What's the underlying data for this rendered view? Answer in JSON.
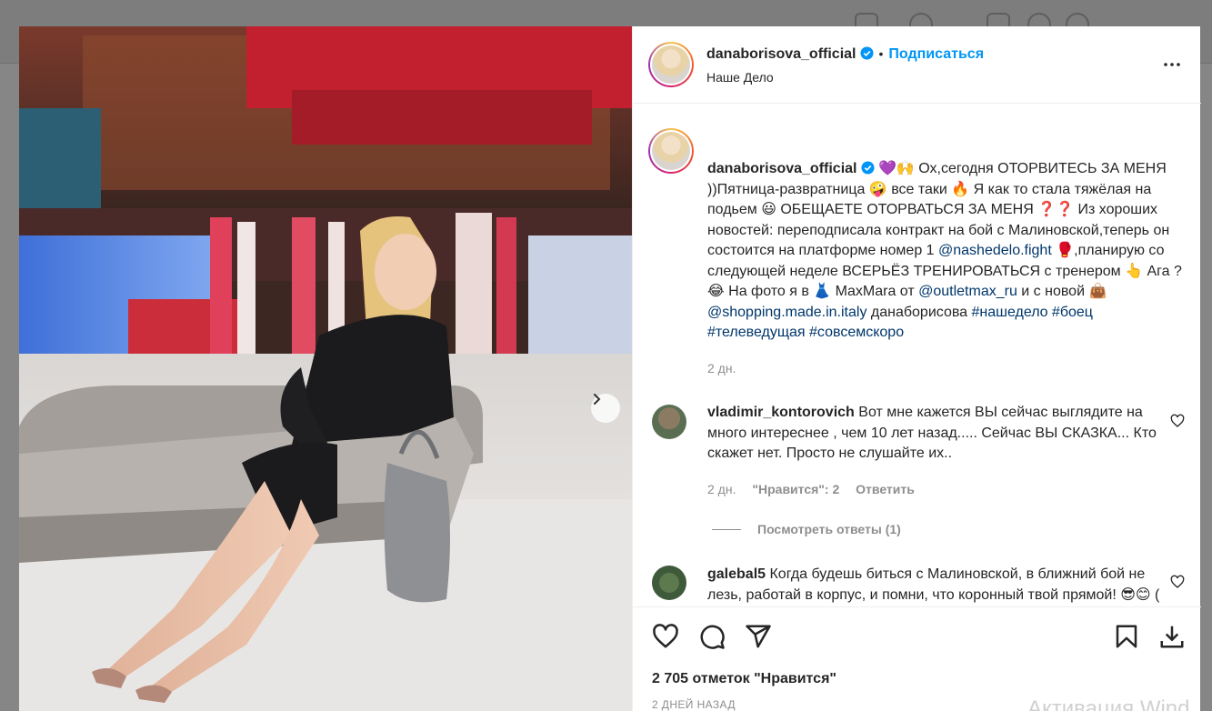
{
  "post": {
    "username": "danaborisova_official",
    "follow_label": "Подписаться",
    "location": "Наше Дело",
    "caption": {
      "username": "danaborisova_official",
      "emoji_lead": "💜🙌",
      "segments": [
        {
          "t": " Ох,сегодня ОТОРВИТЕСЬ ЗА МЕНЯ ))Пятница-развратница 🤪 все таки 🔥 Я как то стала тяжёлая на подьем 😃 ОБЕЩАЕТЕ ОТОРВАТЬСЯ ЗА МЕНЯ ❓❓ Из хороших новостей: переподписала контракт на бой с Малиновской,теперь он состоится на платформе номер 1 "
        },
        {
          "t": "@nashedelo.fight",
          "tag": true
        },
        {
          "t": " 🥊,планирую со следующей неделе ВСЕРЬЁЗ ТРЕНИРОВАТЬСЯ с тренером 👆 Ага ?😂 На фото я в 👗 MaxMara от "
        },
        {
          "t": "@outletmax_ru",
          "tag": true
        },
        {
          "t": " и с новой 👜 "
        },
        {
          "t": "@shopping.made.in.italy",
          "tag": true
        },
        {
          "t": " данаборисова "
        },
        {
          "t": "#нашеделo",
          "tag": true
        },
        {
          "t": " "
        },
        {
          "t": "#боец",
          "tag": true
        },
        {
          "t": " "
        },
        {
          "t": "#телеведущая",
          "tag": true
        },
        {
          "t": " "
        },
        {
          "t": "#совсемскоро",
          "tag": true
        }
      ],
      "time": "2 дн."
    },
    "comments": [
      {
        "username": "vladimir_kontorovich",
        "text": " Вот мне кажется ВЫ сейчас выглядите на много интереснее , чем 10 лет назад..... Сейчас ВЫ СКАЗКА... Кто скажет нет. Просто не слушайте их..",
        "time": "2 дн.",
        "likes": "\"Нравится\": 2",
        "reply_label": "Ответить",
        "view_replies": "Посмотреть ответы (1)"
      },
      {
        "username": "galebal5",
        "text": " Когда будешь биться с Малиновской, в ближний бой не лезь, работай в корпус, и помни, что коронный твой прямой! 😎😊 ( как учил В.С. Высоцкий )"
      }
    ],
    "likes_count": "2 705 отметок \"Нравится\"",
    "date": "2 ДНЕЙ НАЗАД",
    "colors": {
      "accent": "#0095f6",
      "tag": "#00376b",
      "muted": "#8e8e8e"
    }
  },
  "watermark": "Активация Wind"
}
